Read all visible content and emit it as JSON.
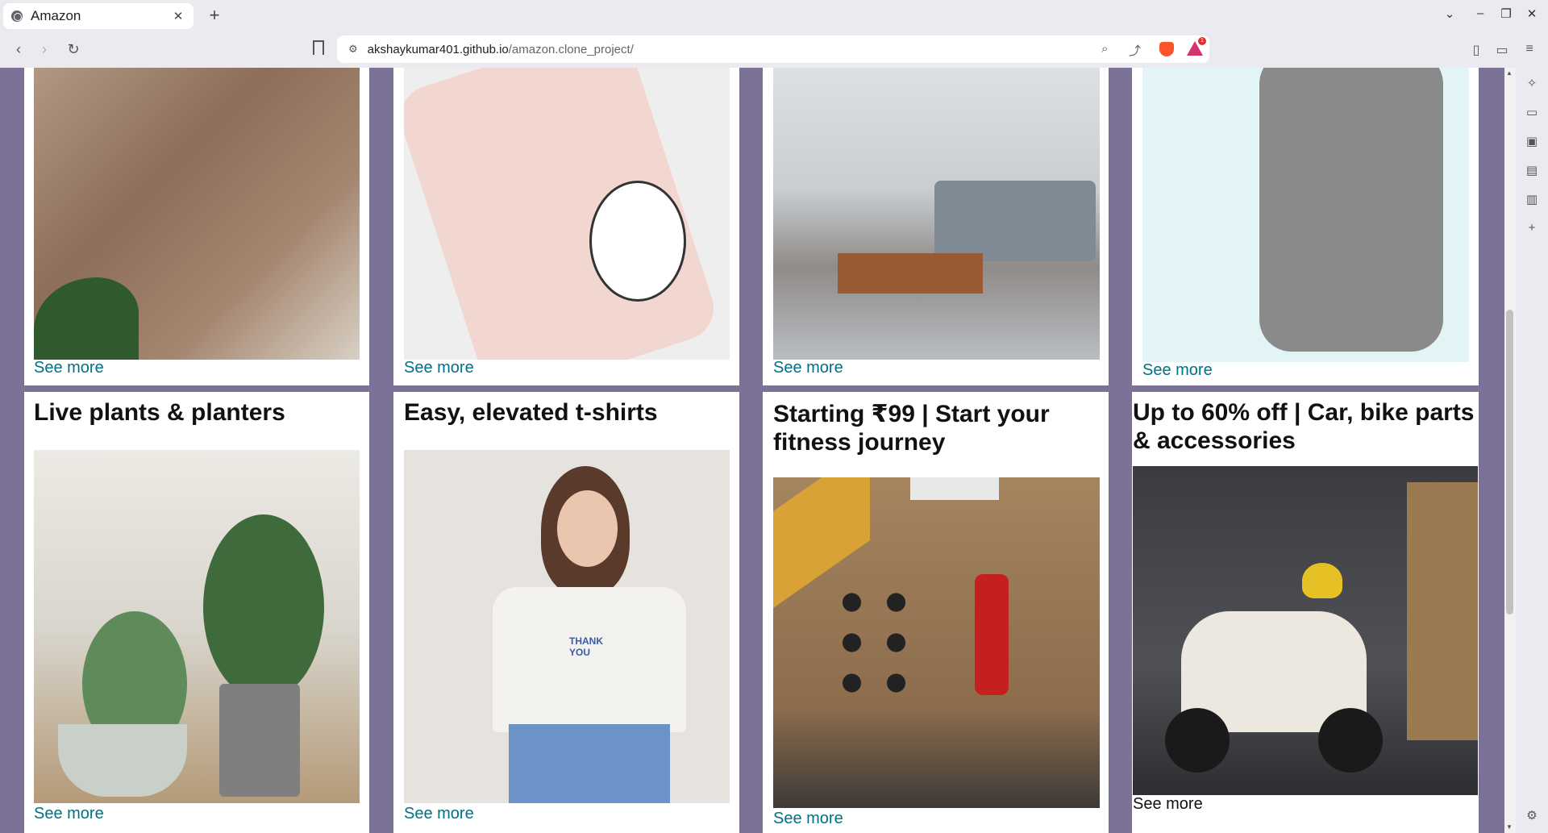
{
  "browser": {
    "tab_title": "Amazon",
    "tab_close": "✕",
    "new_tab": "+",
    "url_host": "akshaykumar401.github.io",
    "url_path": "/amazon.clone_project/",
    "rewards_badge": "1"
  },
  "page": {
    "top_row": [
      {
        "see_more": "See more",
        "image": "leopard-print-dress"
      },
      {
        "see_more": "See more",
        "image": "pink-phone-case-unicorn"
      },
      {
        "see_more": "See more",
        "image": "living-room-furniture"
      },
      {
        "see_more": "See more",
        "image": "smart-speaker"
      }
    ],
    "bottom_row": [
      {
        "title": "Live plants & planters",
        "see_more": "See more",
        "image": "potted-plants"
      },
      {
        "title": "Easy, elevated t-shirts",
        "see_more": "See more",
        "image": "woman-in-thank-you-tshirt"
      },
      {
        "title": "Starting ₹99 | Start your fitness journey",
        "see_more": "See more",
        "image": "home-gym"
      },
      {
        "title": "Up to 60% off | Car, bike parts & accessories",
        "see_more": "See more",
        "image": "scooter-garage"
      }
    ]
  },
  "colors": {
    "background": "#7c7196",
    "link": "#007185",
    "chrome": "#e9ebf0"
  }
}
